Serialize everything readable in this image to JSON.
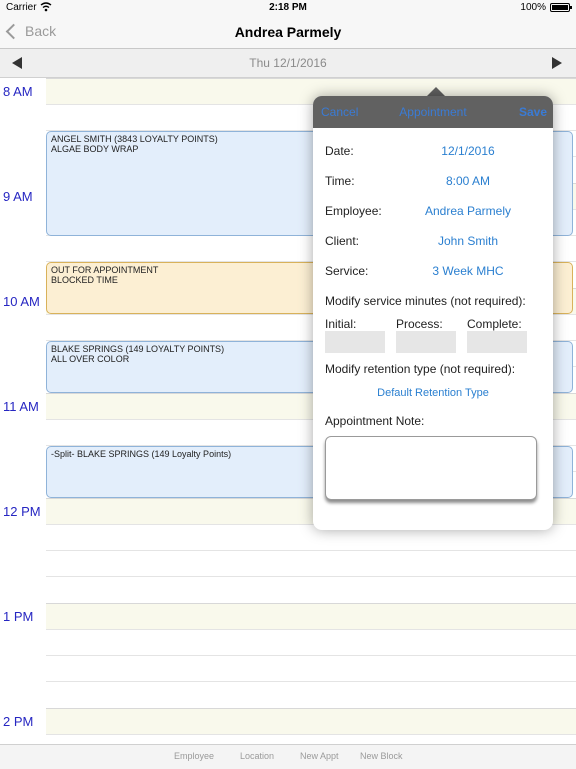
{
  "status_bar": {
    "carrier": "Carrier",
    "time": "2:18 PM",
    "battery": "100%"
  },
  "nav": {
    "back_label": "Back",
    "title": "Andrea Parmely"
  },
  "date_bar": {
    "date": "Thu 12/1/2016"
  },
  "calendar": {
    "hours": [
      "8 AM",
      "9 AM",
      "10 AM",
      "11 AM",
      "12 PM",
      "1 PM",
      "2 PM"
    ],
    "appointments": [
      {
        "line1": "ANGEL SMITH (3843 LOYALTY POINTS)",
        "line2": "ALGAE BODY WRAP"
      },
      {
        "line1": "OUT FOR APPOINTMENT",
        "line2": "BLOCKED TIME"
      },
      {
        "line1": "BLAKE SPRINGS (149 LOYALTY POINTS)",
        "line2": "ALL OVER COLOR"
      },
      {
        "line1": "-Split- BLAKE SPRINGS (149 Loyalty Points)",
        "line2": ""
      }
    ]
  },
  "popover": {
    "cancel_label": "Cancel",
    "title": "Appointment",
    "save_label": "Save",
    "fields": [
      {
        "label": "Date:",
        "value": "12/1/2016"
      },
      {
        "label": "Time:",
        "value": "8:00 AM"
      },
      {
        "label": "Employee:",
        "value": "Andrea Parmely"
      },
      {
        "label": "Client:",
        "value": "John Smith"
      },
      {
        "label": "Service:",
        "value": "3 Week MHC"
      }
    ],
    "modify_minutes_label": "Modify service minutes (not required):",
    "initial_label": "Initial:",
    "process_label": "Process:",
    "complete_label": "Complete:",
    "initial_value": "",
    "process_value": "",
    "complete_value": "",
    "modify_retention_label": "Modify retention type (not required):",
    "retention_value": "Default Retention Type",
    "note_label": "Appointment Note:",
    "note_value": ""
  },
  "tab_bar": {
    "employee": "Employee",
    "location": "Location",
    "new_appt": "New Appt",
    "new_block": "New Block"
  },
  "colors": {
    "accent": "#2a7fd0",
    "hour_label": "#2626c2",
    "appt_blue": "#e3eefb",
    "appt_gold": "#fcefd3"
  }
}
